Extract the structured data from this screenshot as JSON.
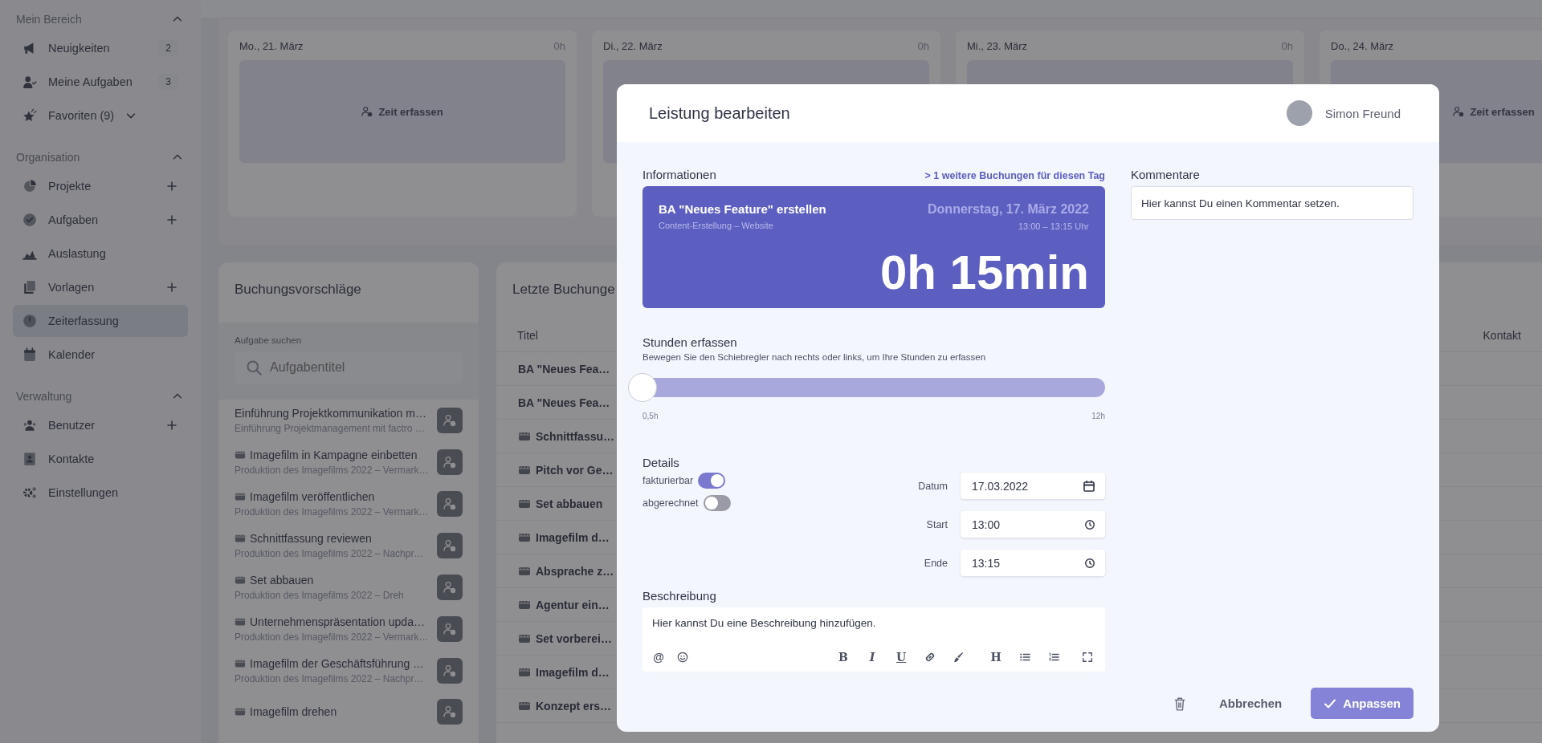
{
  "sidebar": {
    "sections": [
      {
        "title": "Mein Bereich",
        "expanded": true,
        "items": [
          {
            "label": "Neuigkeiten",
            "badge": "2",
            "add": false,
            "selected": false
          },
          {
            "label": "Meine Aufgaben",
            "badge": "3",
            "add": false,
            "selected": false
          },
          {
            "label": "Favoriten (9)",
            "add": false,
            "selected": false,
            "expanded": false
          }
        ]
      },
      {
        "title": "Organisation",
        "expanded": true,
        "items": [
          {
            "label": "Projekte",
            "add": true,
            "selected": false
          },
          {
            "label": "Aufgaben",
            "add": true,
            "selected": false
          },
          {
            "label": "Auslastung",
            "add": false,
            "selected": false
          },
          {
            "label": "Vorlagen",
            "add": true,
            "selected": false
          },
          {
            "label": "Zeiterfassung",
            "add": false,
            "selected": true
          },
          {
            "label": "Kalender",
            "add": false,
            "selected": false
          }
        ]
      },
      {
        "title": "Verwaltung",
        "expanded": true,
        "items": [
          {
            "label": "Benutzer",
            "add": true,
            "selected": false
          },
          {
            "label": "Kontakte",
            "add": false,
            "selected": false
          },
          {
            "label": "Einstellungen",
            "add": false,
            "selected": false
          }
        ]
      }
    ]
  },
  "week": {
    "days": [
      {
        "day": "Mo., 21. März",
        "hours": "0h",
        "button": "Zeit erfassen"
      },
      {
        "day": "Di., 22. März",
        "hours": "0h"
      },
      {
        "day": "Mi., 23. März",
        "hours": "0h"
      },
      {
        "day": "Do., 24. März",
        "button": "Zeit erfassen"
      }
    ]
  },
  "suggestions": {
    "title": "Buchungsvorschläge",
    "search_label": "Aufgabe suchen",
    "search": {
      "placeholder": "Aufgabentitel"
    },
    "items": [
      {
        "title": "Einführung Projektkommunikation m…",
        "subtitle": "Einführung Projektmanagement mit factro …",
        "kind": "plain"
      },
      {
        "title": "Imagefilm in Kampagne einbetten",
        "subtitle": "Produktion des Imagefilms 2022 – Vermark…",
        "kind": "emoji"
      },
      {
        "title": "Imagefilm veröffentlichen",
        "subtitle": "Produktion des Imagefilms 2022 – Vermark…",
        "kind": "emoji"
      },
      {
        "title": "Schnittfassung reviewen",
        "subtitle": "Produktion des Imagefilms 2022 – Nachpr…",
        "kind": "emoji"
      },
      {
        "title": "Set abbauen",
        "subtitle": "Produktion des Imagefilms 2022 – Dreh",
        "kind": "emoji"
      },
      {
        "title": "Unternehmenspräsentation upda…",
        "subtitle": "Produktion des Imagefilms 2022 – Vermark…",
        "kind": "emoji"
      },
      {
        "title": "Imagefilm der Geschäftsführung …",
        "subtitle": "Produktion des Imagefilms 2022 – Nachpr…",
        "kind": "emoji"
      },
      {
        "title": "Imagefilm drehen",
        "kind": "emoji"
      }
    ]
  },
  "recent": {
    "title": "Letzte Buchunge",
    "columns": [
      "Titel",
      "Kontakt"
    ],
    "rows": [
      {
        "title": "BA \"Neues Fea…",
        "kind": "plain"
      },
      {
        "title": "BA \"Neues Fea…",
        "kind": "plain"
      },
      {
        "title": "Schnittfassu…",
        "kind": "emoji"
      },
      {
        "title": "Pitch vor Ge…",
        "kind": "emoji"
      },
      {
        "title": "Set abbauen",
        "kind": "emoji"
      },
      {
        "title": "Imagefilm d…",
        "kind": "emoji"
      },
      {
        "title": "Absprache z…",
        "kind": "emoji"
      },
      {
        "title": "Agentur ein…",
        "kind": "emoji"
      },
      {
        "title": "Set vorberei…",
        "kind": "emoji"
      },
      {
        "title": "Imagefilm d…",
        "kind": "emoji"
      },
      {
        "title": "Konzept ers…",
        "kind": "emoji"
      }
    ]
  },
  "dialog": {
    "title": "Leistung bearbeiten",
    "user": "Simon Freund",
    "info": {
      "label": "Informationen",
      "link": "> 1 weitere Buchungen für diesen Tag",
      "task": "BA \"Neues Feature\" erstellen",
      "project": "Content-Erstellung – Website",
      "date": "Donnerstag, 17. März 2022",
      "time": "13:00 – 13:15 Uhr",
      "duration": "0h 15min"
    },
    "hours": {
      "label": "Stunden erfassen",
      "hint": "Bewegen Sie den Schiebregler nach rechts oder links, um Ihre Stunden zu erfassen",
      "level": 0,
      "min": "0,5h",
      "max": "12h"
    },
    "details": {
      "label": "Details",
      "toggles": [
        {
          "label": "fakturierbar",
          "on": true
        },
        {
          "label": "abgerechnet",
          "on": false
        }
      ],
      "fields": [
        {
          "label": "Datum",
          "value": "17.03.2022",
          "kind": "date"
        },
        {
          "label": "Start",
          "value": "13:00",
          "kind": "time"
        },
        {
          "label": "Ende",
          "value": "13:15",
          "kind": "time"
        }
      ]
    },
    "description": {
      "label": "Beschreibung",
      "placeholder": "Hier kannst Du eine Beschreibung hinzufügen.",
      "toolbar": [
        {
          "kind": "mention",
          "label": "@"
        },
        {
          "kind": "emoji"
        },
        {
          "kind": "bold",
          "label": "B"
        },
        {
          "kind": "italic",
          "label": "I"
        },
        {
          "kind": "underline",
          "label": "U"
        },
        {
          "kind": "link"
        },
        {
          "kind": "brush"
        },
        {
          "kind": "heading",
          "label": "H"
        },
        {
          "kind": "bullets"
        },
        {
          "kind": "numbers"
        },
        {
          "kind": "fullscreen"
        }
      ]
    },
    "comments": {
      "label": "Kommentare",
      "placeholder": "Hier kannst Du einen Kommentar setzen."
    },
    "buttons": {
      "cancel": "Abbrechen",
      "confirm": "Anpassen"
    }
  }
}
